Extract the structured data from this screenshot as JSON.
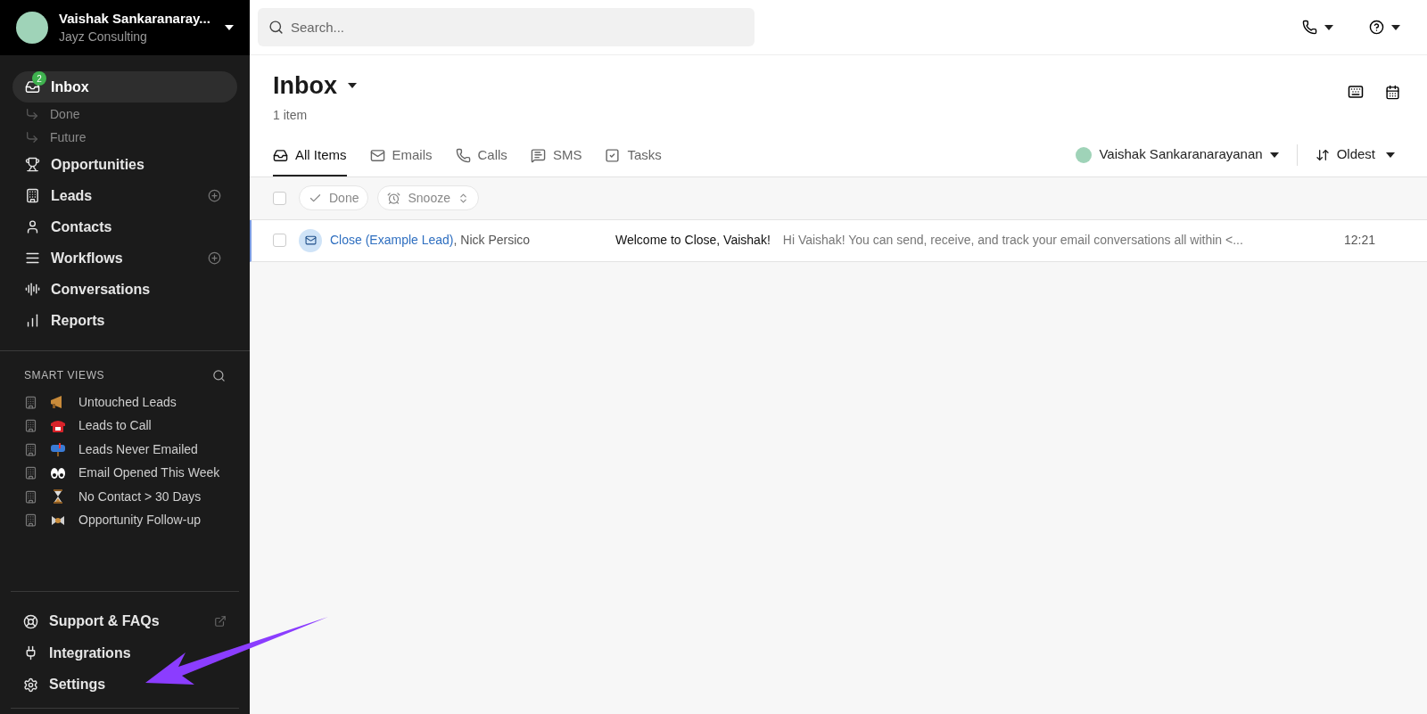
{
  "account": {
    "name": "Vaishak Sankaranaray...",
    "company": "Jayz Consulting"
  },
  "nav": [
    {
      "label": "Inbox",
      "selected": true,
      "badge": "2",
      "add": false,
      "children": [
        {
          "label": "Done"
        },
        {
          "label": "Future"
        }
      ]
    },
    {
      "label": "Opportunities",
      "selected": false,
      "add": false
    },
    {
      "label": "Leads",
      "selected": false,
      "add": true
    },
    {
      "label": "Contacts",
      "selected": false,
      "add": false
    },
    {
      "label": "Workflows",
      "selected": false,
      "add": true
    },
    {
      "label": "Conversations",
      "selected": false,
      "add": false
    },
    {
      "label": "Reports",
      "selected": false,
      "add": false
    }
  ],
  "smart_views": {
    "title": "SMART VIEWS",
    "items": [
      {
        "label": "Untouched Leads"
      },
      {
        "label": "Leads to Call"
      },
      {
        "label": "Leads Never Emailed"
      },
      {
        "label": "Email Opened This Week"
      },
      {
        "label": "No Contact > 30 Days"
      },
      {
        "label": "Opportunity Follow-up"
      }
    ]
  },
  "footer_nav": [
    {
      "label": "Support & FAQs",
      "external": true
    },
    {
      "label": "Integrations",
      "external": false
    },
    {
      "label": "Settings",
      "external": false
    }
  ],
  "search": {
    "placeholder": "Search..."
  },
  "inbox": {
    "title": "Inbox",
    "count": "1 item"
  },
  "tabs": [
    {
      "label": "All Items",
      "selected": true
    },
    {
      "label": "Emails",
      "selected": false
    },
    {
      "label": "Calls",
      "selected": false
    },
    {
      "label": "SMS",
      "selected": false
    },
    {
      "label": "Tasks",
      "selected": false
    }
  ],
  "filters": {
    "user": "Vaishak Sankaranarayanan",
    "sort": "Oldest"
  },
  "toolbar": {
    "select_all_checked": false,
    "actions": [
      "Done",
      "Snooze"
    ]
  },
  "rows": [
    {
      "lead": "Close (Example Lead)",
      "contact": ", Nick Persico",
      "subject": "Welcome to Close, Vaishak!",
      "preview": "Hi Vaishak! You can send, receive, and track your email conversations all within <...",
      "time": "12:21",
      "checked": false,
      "selected": true
    }
  ]
}
